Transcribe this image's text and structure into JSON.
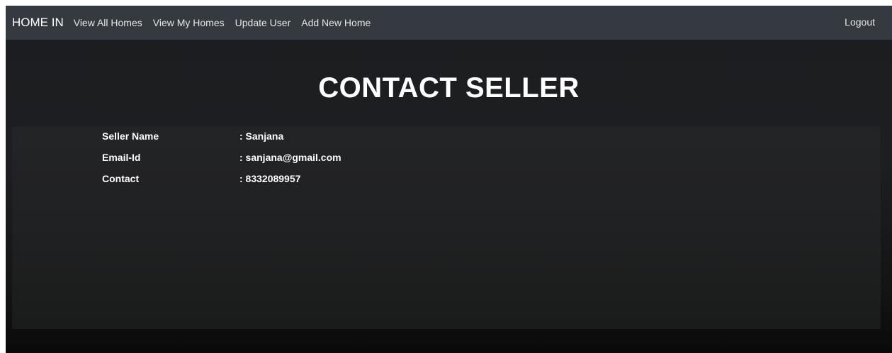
{
  "navbar": {
    "brand": "HOME IN",
    "links": [
      {
        "label": "View All Homes"
      },
      {
        "label": "View My Homes"
      },
      {
        "label": "Update User"
      },
      {
        "label": "Add New Home"
      }
    ],
    "logout": "Logout"
  },
  "main": {
    "title": "CONTACT SELLER",
    "seller": {
      "name_label": "Seller Name",
      "name_value": ": Sanjana",
      "email_label": "Email-Id",
      "email_value": ": sanjana@gmail.com",
      "contact_label": "Contact",
      "contact_value": ": 8332089957"
    }
  },
  "colors": {
    "navbar_bg": "#343a40",
    "page_bg": "#1c1d20",
    "text": "#ffffff"
  }
}
